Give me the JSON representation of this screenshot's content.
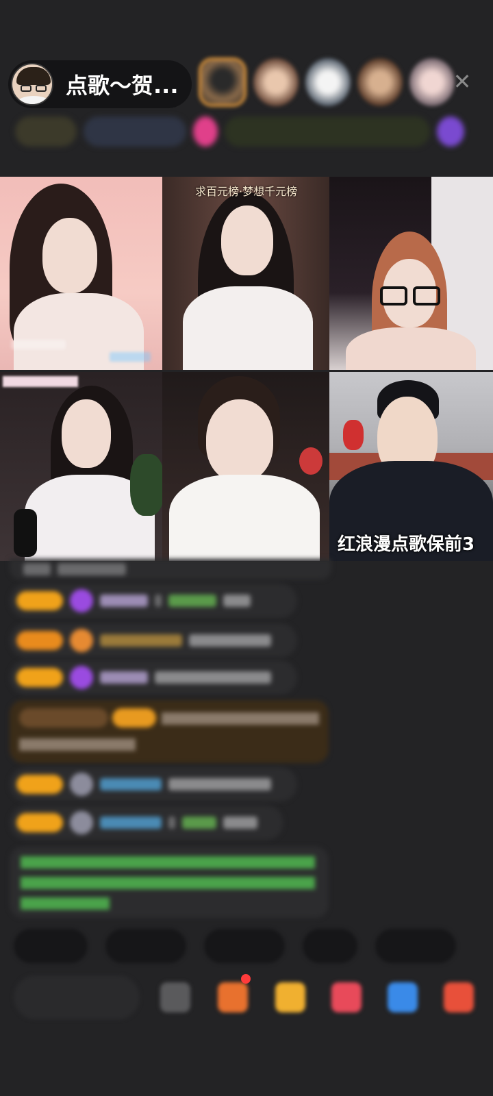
{
  "header": {
    "host_title": "点歌～贺...",
    "close_icon": "close-icon"
  },
  "grid": {
    "cell2_caption": "求百元榜·梦想千元榜",
    "cell6_caption": "红浪漫点歌保前3"
  },
  "colors": {
    "background": "#232325",
    "level_badge": "#f0a21a",
    "gem_purple": "#9a4be0",
    "chat_bubble": "#2c2c2e",
    "highlight_bubble": "#3b2c18",
    "green_notice": "#4aa34a"
  }
}
